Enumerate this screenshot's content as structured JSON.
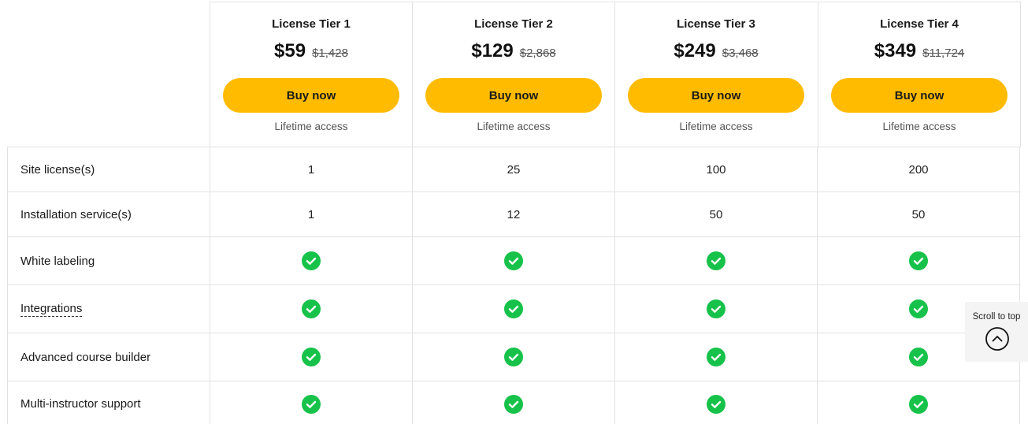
{
  "tiers": [
    {
      "name": "License Tier 1",
      "price": "$59",
      "old_price": "$1,428",
      "button": "Buy now",
      "access": "Lifetime access"
    },
    {
      "name": "License Tier 2",
      "price": "$129",
      "old_price": "$2,868",
      "button": "Buy now",
      "access": "Lifetime access"
    },
    {
      "name": "License Tier 3",
      "price": "$249",
      "old_price": "$3,468",
      "button": "Buy now",
      "access": "Lifetime access"
    },
    {
      "name": "License Tier 4",
      "price": "$349",
      "old_price": "$11,724",
      "button": "Buy now",
      "access": "Lifetime access"
    }
  ],
  "features": [
    {
      "label": "Site license(s)",
      "values": [
        "1",
        "25",
        "100",
        "200"
      ]
    },
    {
      "label": "Installation service(s)",
      "values": [
        "1",
        "12",
        "50",
        "50"
      ]
    },
    {
      "label": "White labeling",
      "values": [
        "check-icon",
        "check-icon",
        "check-icon",
        "check-icon"
      ]
    },
    {
      "label": "Integrations",
      "values": [
        "check-icon",
        "check-icon",
        "check-icon",
        "check-icon"
      ]
    },
    {
      "label": "Advanced course builder",
      "values": [
        "check-icon",
        "check-icon",
        "check-icon",
        "check-icon"
      ]
    },
    {
      "label": "Multi-instructor support",
      "values": [
        "check-icon",
        "check-icon",
        "check-icon",
        "check-icon"
      ]
    }
  ],
  "scroll_to_top": {
    "label": "Scroll to top",
    "icon": "chevron-up-icon"
  },
  "colors": {
    "button": "#ffbb00",
    "check": "#17c24a",
    "border": "#e2e2e2"
  }
}
